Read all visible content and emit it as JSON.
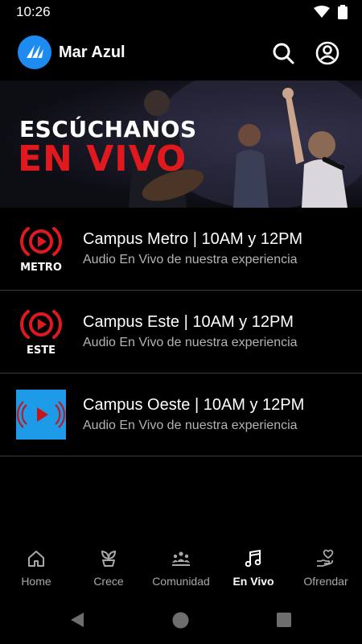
{
  "status": {
    "time": "10:26"
  },
  "appbar": {
    "title": "Mar Azul"
  },
  "banner": {
    "line1": "ESCÚCHANOS",
    "line2": "EN VIVO"
  },
  "campuses": [
    {
      "thumb_label": "METRO",
      "title": "Campus Metro | 10AM y 12PM",
      "subtitle": "Audio En Vivo de nuestra experiencia"
    },
    {
      "thumb_label": "ESTE",
      "title": "Campus Este | 10AM y 12PM",
      "subtitle": "Audio En Vivo de nuestra experiencia"
    },
    {
      "thumb_label": "",
      "title": "Campus Oeste | 10AM y 12PM",
      "subtitle": "Audio En Vivo de nuestra experiencia"
    }
  ],
  "nav": [
    {
      "label": "Home",
      "icon": "home-icon",
      "active": false
    },
    {
      "label": "Crece",
      "icon": "sprout-icon",
      "active": false
    },
    {
      "label": "Comunidad",
      "icon": "community-icon",
      "active": false
    },
    {
      "label": "En Vivo",
      "icon": "music-note-icon",
      "active": true
    },
    {
      "label": "Ofrendar",
      "icon": "giving-hand-icon",
      "active": false
    }
  ],
  "colors": {
    "accent_red": "#e0191f",
    "logo_blue": "#1e8bf1",
    "oeste_blue": "#1d9be8"
  }
}
